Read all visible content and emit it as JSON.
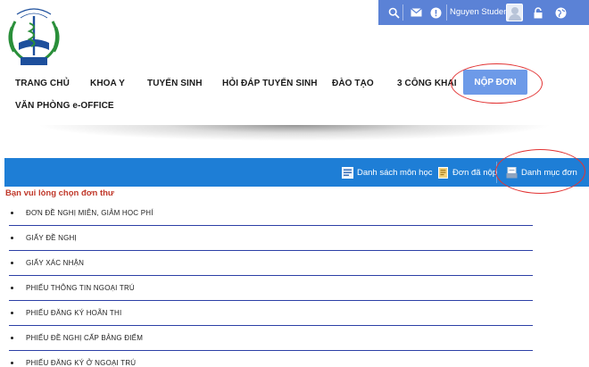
{
  "user_bar": {
    "username": "Nguyen Student",
    "icons": [
      "search-icon",
      "mail-icon",
      "alert-icon",
      "avatar",
      "lock-icon",
      "globe-icon"
    ],
    "background": "#5b82d6"
  },
  "nav": {
    "items": [
      "TRANG CHỦ",
      "KHOA Y",
      "TUYỂN SINH",
      "HỎI ĐÁP TUYỂN SINH",
      "ĐÀO TẠO",
      "3 CÔNG KHAI",
      "VĂN PHÒNG e-OFFICE"
    ],
    "active": "NỘP ĐƠN",
    "active_color": "#6d9ae8"
  },
  "toolbar": {
    "items": [
      "Danh sách môn học",
      "Đơn đã nộp",
      "Danh mục đơn"
    ],
    "background": "#1e7ed6"
  },
  "prompt": "Bạn vui lòng chọn đơn thư",
  "forms": [
    "ĐƠN ĐỀ NGHỊ MIỄN, GIẢM HỌC PHÍ",
    "GIẤY ĐỀ NGHỊ",
    "GIẤY XÁC NHẬN",
    "PHIẾU THÔNG TIN NGOẠI TRÚ",
    "PHIẾU ĐĂNG KÝ HOÃN THI",
    "PHIẾU ĐỀ NGHỊ CẤP BẢNG ĐIỂM",
    "PHIẾU ĐĂNG KÝ Ở NGOẠI TRÚ"
  ],
  "highlight_color": "#e23333",
  "separator_color": "#2c3fa6"
}
